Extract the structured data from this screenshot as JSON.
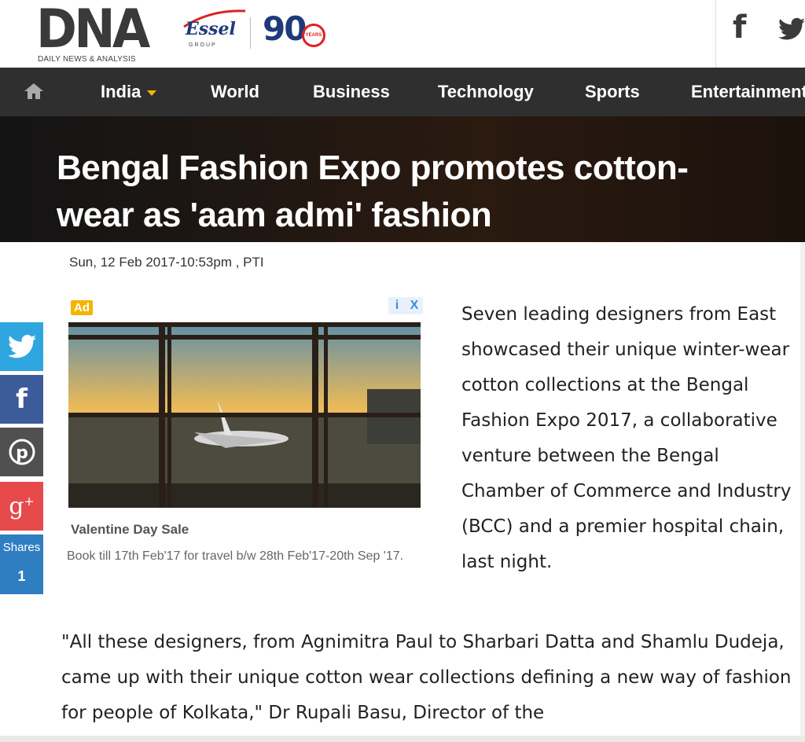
{
  "header": {
    "logo_text": "DNA",
    "logo_subtitle": "DAILY NEWS & ANALYSIS",
    "partner_logo": "Essel",
    "partner_sub": "GROUP",
    "anniversary": "90",
    "anniversary_badge": "YEARS",
    "social": [
      "facebook-icon",
      "twitter-icon"
    ]
  },
  "nav": {
    "items": [
      {
        "label": "India",
        "has_dropdown": true
      },
      {
        "label": "World"
      },
      {
        "label": "Business"
      },
      {
        "label": "Technology"
      },
      {
        "label": "Sports"
      },
      {
        "label": "Entertainment"
      }
    ]
  },
  "article": {
    "headline": "Bengal Fashion Expo promotes cotton-wear as 'aam admi' fashion",
    "dateline": "Sun, 12 Feb 2017-10:53pm , PTI",
    "paragraph1": "Seven leading designers from East showcased their unique winter-wear cotton collections at the Bengal Fashion Expo 2017, a collaborative venture between the Bengal Chamber of Commerce and Industry (BCC) and a premier hospital chain, last night.",
    "paragraph2": "\"All these designers, from Agnimitra Paul to Sharbari Datta and Shamlu Dudeja, came up with their unique cotton wear collections defining a new way of fashion for people of Kolkata,\" Dr Rupali Basu, Director of the"
  },
  "ad": {
    "badge": "Ad",
    "info_icon": "i",
    "close_icon": "X",
    "title": "Valentine Day Sale",
    "description": "Book till 17th Feb'17 for travel b/w 28th Feb'17-20th Sep '17."
  },
  "share": {
    "label": "Shares",
    "count": "1",
    "colors": {
      "twitter": "#2fa6e0",
      "facebook": "#3b5b99",
      "pinterest": "#505050",
      "google_plus": "#e64a4a",
      "count": "#2f7ec1"
    }
  }
}
